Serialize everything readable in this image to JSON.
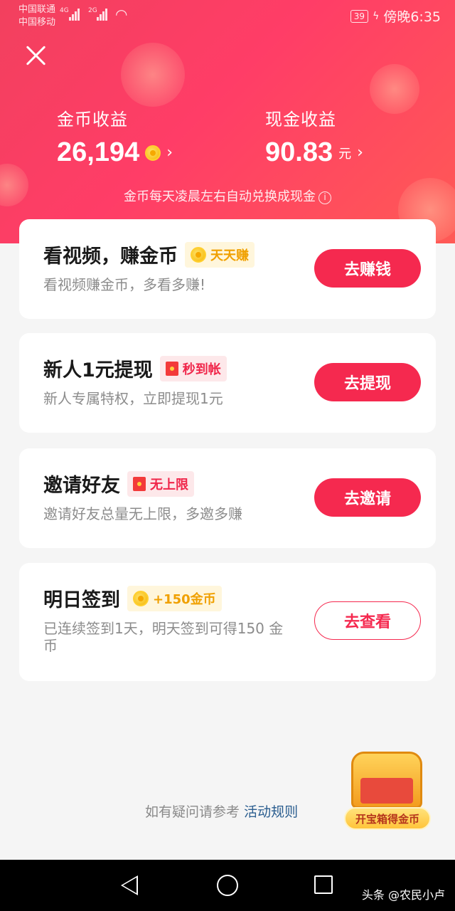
{
  "status_bar": {
    "carrier1": "中国联通",
    "carrier2": "中国移动",
    "net1": "4G",
    "net2": "2G",
    "battery": "39",
    "time": "傍晚6:35"
  },
  "header": {
    "coin_label": "金币收益",
    "coin_value": "26,194",
    "cash_label": "现金收益",
    "cash_value": "90.83",
    "cash_unit": "元",
    "tip": "金币每天凌晨左右自动兑换成现金"
  },
  "cards": [
    {
      "title": "看视频，赚金币",
      "tag": "天天赚",
      "desc": "看视频赚金币，多看多赚!",
      "button": "去赚钱"
    },
    {
      "title": "新人1元提现",
      "tag": "秒到帐",
      "desc": "新人专属特权，立即提现1元",
      "button": "去提现"
    },
    {
      "title": "邀请好友",
      "tag": "无上限",
      "desc": "邀请好友总量无上限，多邀多赚",
      "button": "去邀请"
    },
    {
      "title": "明日签到",
      "tag": "+150金币",
      "desc": "已连续签到1天，明天签到可得150 金币",
      "button": "去查看"
    }
  ],
  "footer": {
    "note": "如有疑问请参考",
    "link": "活动规则"
  },
  "chest": {
    "label": "开宝箱得金币"
  },
  "watermark": "头条 @农民小卢",
  "colors": {
    "accent": "#f5294f",
    "gold": "#f0a000"
  }
}
